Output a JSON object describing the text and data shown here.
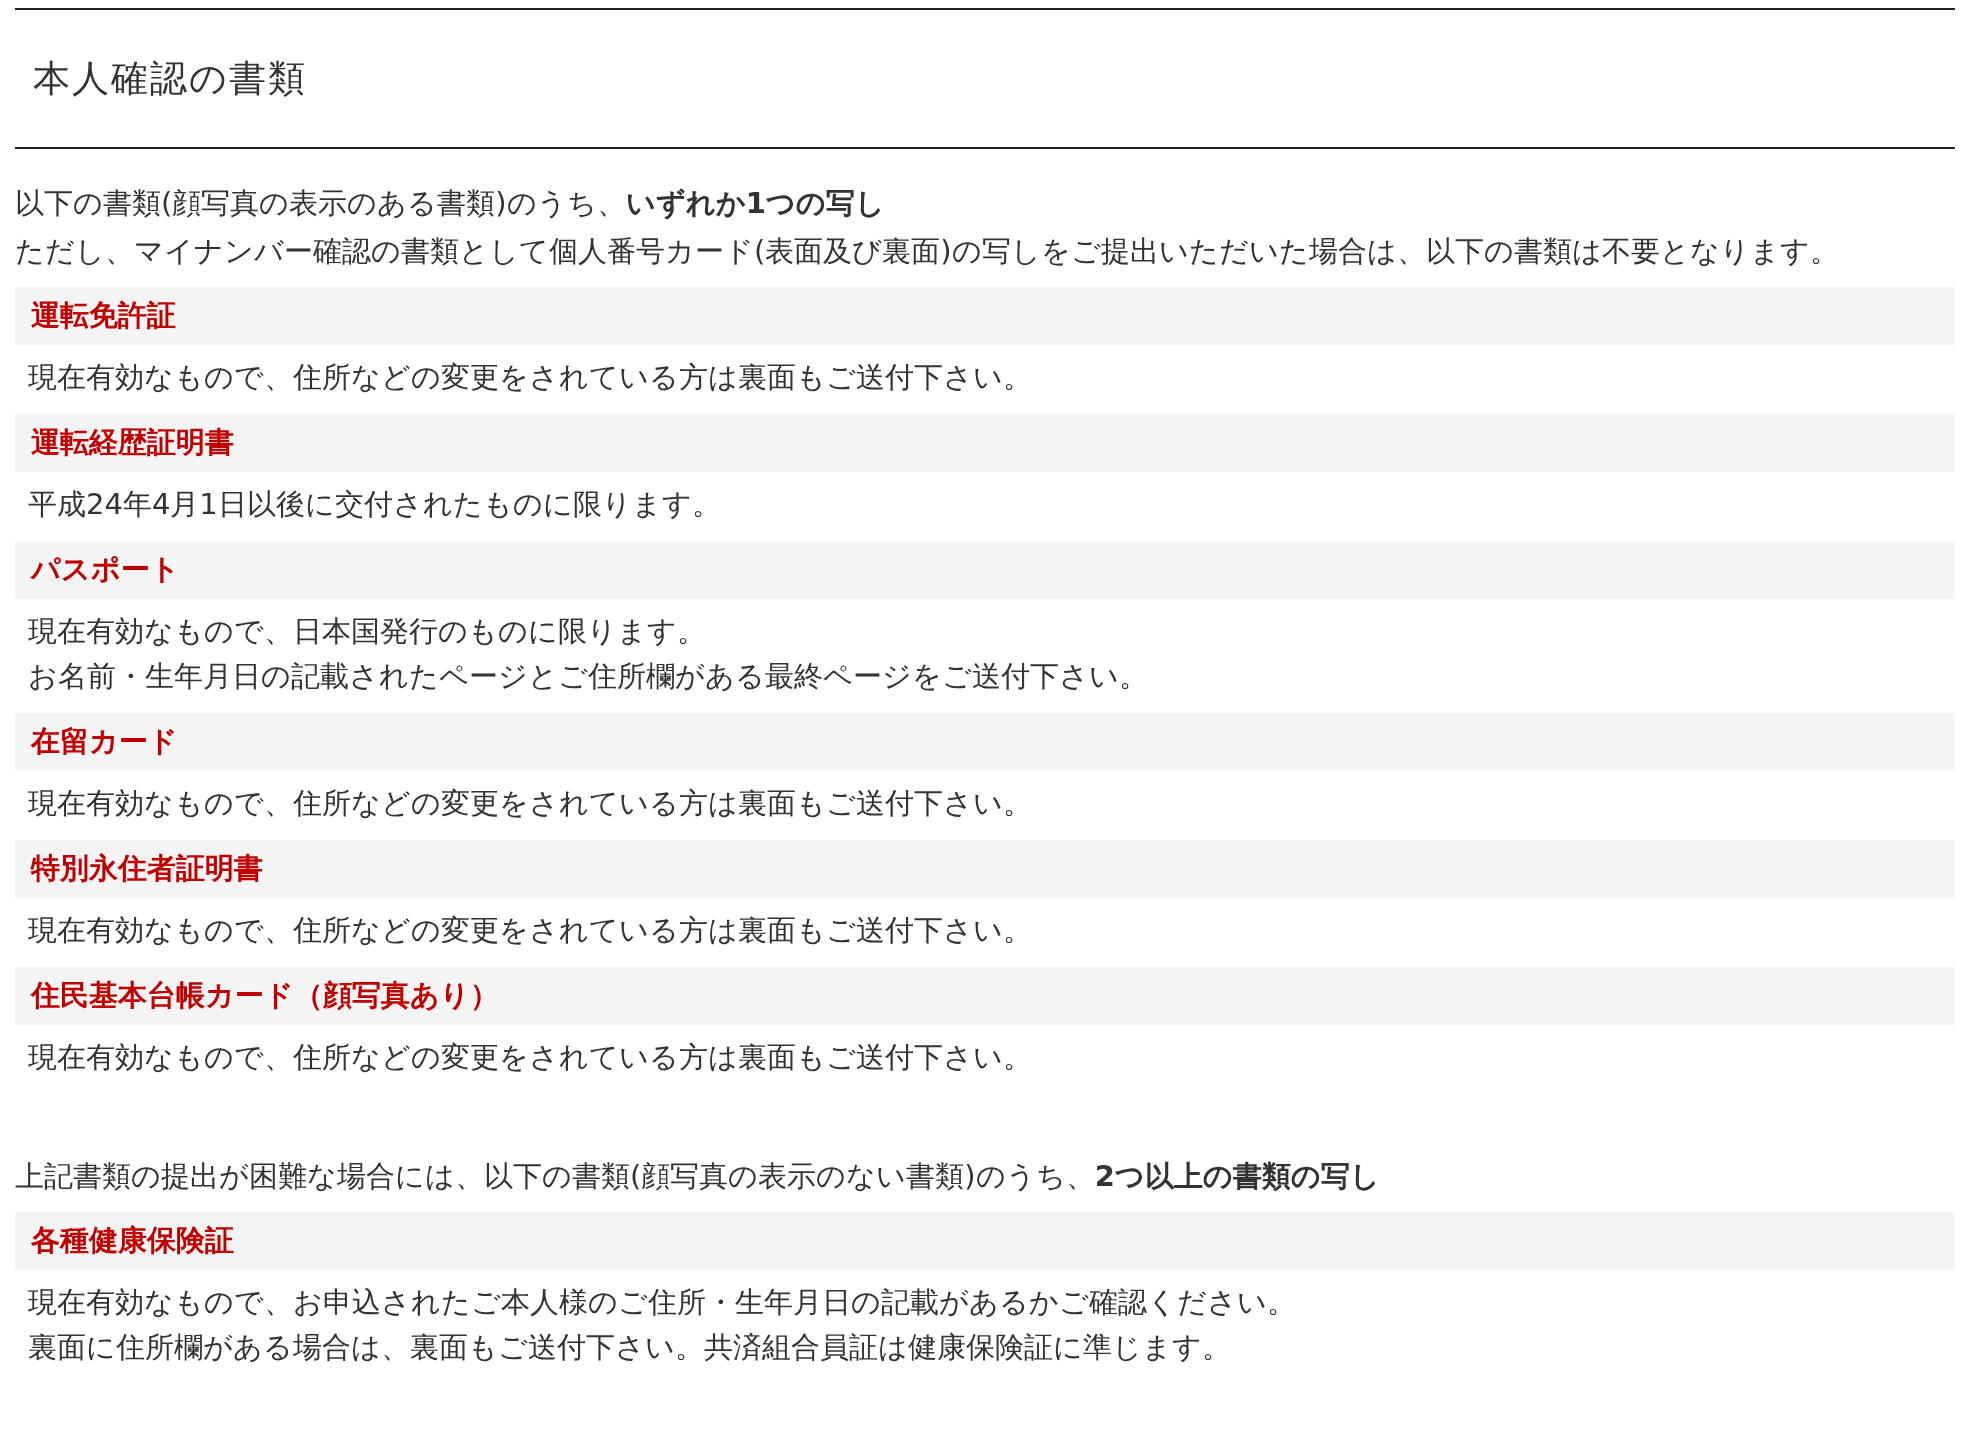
{
  "title": "本人確認の書類",
  "sections": [
    {
      "intro": [
        "以下の書類(顔写真の表示のある書類)のうち、**いずれか1つの写し**",
        "ただし、マイナンバー確認の書類として個人番号カード(表面及び裏面)の写しをご提出いただいた場合は、以下の書類は不要となります。"
      ],
      "documents": [
        {
          "name": "運転免許証",
          "notes": [
            "現在有効なもので、住所などの変更をされている方は裏面もご送付下さい。"
          ]
        },
        {
          "name": "運転経歴証明書",
          "notes": [
            "平成24年4月1日以後に交付されたものに限ります。"
          ]
        },
        {
          "name": "パスポート",
          "notes": [
            "現在有効なもので、日本国発行のものに限ります。",
            "お名前・生年月日の記載されたページとご住所欄がある最終ページをご送付下さい。"
          ]
        },
        {
          "name": "在留カード",
          "notes": [
            "現在有効なもので、住所などの変更をされている方は裏面もご送付下さい。"
          ]
        },
        {
          "name": "特別永住者証明書",
          "notes": [
            "現在有効なもので、住所などの変更をされている方は裏面もご送付下さい。"
          ]
        },
        {
          "name": "住民基本台帳カード（顔写真あり）",
          "notes": [
            "現在有効なもので、住所などの変更をされている方は裏面もご送付下さい。"
          ]
        }
      ]
    },
    {
      "intro": [
        "上記書類の提出が困難な場合には、以下の書類(顔写真の表示のない書類)のうち、**2つ以上の書類の写し**"
      ],
      "documents": [
        {
          "name": "各種健康保険証",
          "notes": [
            "現在有効なもので、お申込されたご本人様のご住所・生年月日の記載があるかご確認ください。",
            "裏面に住所欄がある場合は、裏面もご送付下さい。共済組合員証は健康保険証に準じます。"
          ]
        }
      ]
    }
  ]
}
